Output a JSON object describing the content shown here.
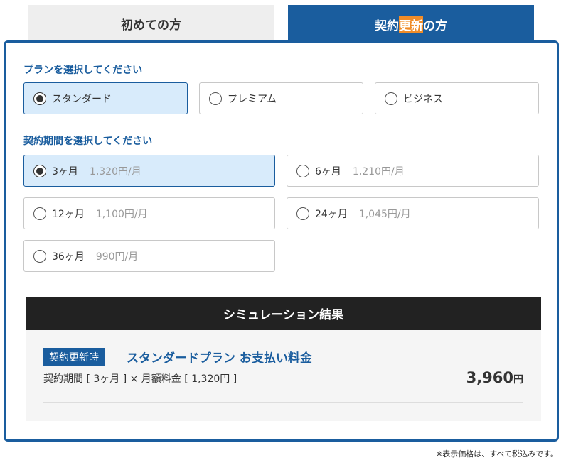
{
  "tabs": {
    "first_label": "初めての方",
    "renew_pre": "契約",
    "renew_highlight": "更新",
    "renew_post": "の方"
  },
  "plan_section": {
    "label": "プランを選択してください",
    "options": [
      {
        "label": "スタンダード",
        "selected": true
      },
      {
        "label": "プレミアム",
        "selected": false
      },
      {
        "label": "ビジネス",
        "selected": false
      }
    ]
  },
  "period_section": {
    "label": "契約期間を選択してください",
    "options": [
      {
        "label": "3ヶ月",
        "price": "1,320円/月",
        "selected": true
      },
      {
        "label": "6ヶ月",
        "price": "1,210円/月",
        "selected": false
      },
      {
        "label": "12ヶ月",
        "price": "1,100円/月",
        "selected": false
      },
      {
        "label": "24ヶ月",
        "price": "1,045円/月",
        "selected": false
      },
      {
        "label": "36ヶ月",
        "price": "990円/月",
        "selected": false
      }
    ]
  },
  "simulation": {
    "header": "シミュレーション結果",
    "badge": "契約更新時",
    "title": "スタンダードプラン お支払い料金",
    "formula": "契約期間 [ 3ヶ月 ] × 月額料金 [ 1,320円 ]",
    "total_amount": "3,960",
    "total_unit": "円"
  },
  "footnote": "※表示価格は、すべて税込みです。",
  "colors": {
    "accent": "#1a5d9e",
    "highlight": "#f08c28",
    "selected_bg": "#d8ebfb",
    "sim_header_bg": "#222222"
  }
}
